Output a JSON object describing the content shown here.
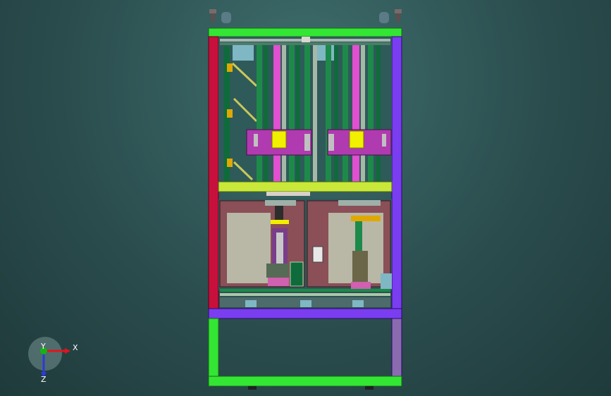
{
  "viewport": {
    "background_top": "#3f6e6d",
    "background_bottom": "#1f3a3b"
  },
  "model": {
    "frame_color": "#33e633",
    "left_post_color": "#c8103c",
    "right_post_color": "#7a3df0",
    "base_beam_color": "#7a3df0",
    "column_colors": [
      "#e24fd0",
      "#1d8a4a",
      "#0f6b3b",
      "#a6b8a6"
    ],
    "slider_color": "#f0f000",
    "panel_color": "#8a4f57",
    "plate_color": "#b9b7a6",
    "bracket_color": "#b03ab0"
  },
  "triad": {
    "x_label": "X",
    "y_label": "Y",
    "z_label": "Z",
    "x_color": "#e3141c",
    "y_color": "#16b316",
    "z_color": "#2b3bd6"
  }
}
